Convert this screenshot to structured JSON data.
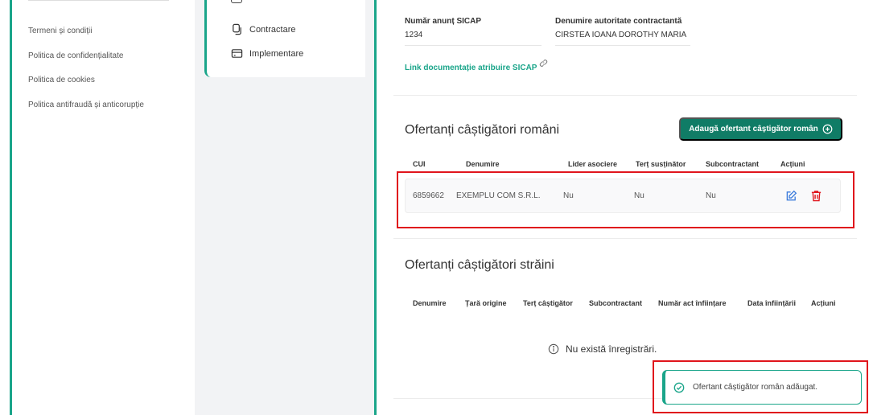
{
  "footer_links": [
    "Termeni și condiții",
    "Politica de confidențialitate",
    "Politica de cookies",
    "Politica antifraudă și anticorupție"
  ],
  "side_menu": {
    "items": [
      {
        "label": "Contractare",
        "icon": "document-copy-icon"
      },
      {
        "label": "Implementare",
        "icon": "credit-card-icon"
      }
    ]
  },
  "info": {
    "sicap_label": "Număr anunț SICAP",
    "sicap_value": "1234",
    "authority_label": "Denumire autoritate contractantă",
    "authority_value": "CIRSTEA IOANA DOROTHY MARIA",
    "doc_link": "Link documentație atribuire SICAP"
  },
  "romanian_winners": {
    "title": "Ofertanți câștigători români",
    "add_button": "Adaugă ofertant câștigător român",
    "columns": [
      "CUI",
      "Denumire",
      "Lider asociere",
      "Terț susținător",
      "Subcontractant",
      "Acțiuni"
    ],
    "rows": [
      {
        "cui": "6859662",
        "denumire": "EXEMPLU COM S.R.L.",
        "lider": "Nu",
        "tert": "Nu",
        "subcontractant": "Nu"
      }
    ]
  },
  "foreign_winners": {
    "title": "Ofertanți câștigători străini",
    "columns": [
      "Denumire",
      "Țară origine",
      "Terț câștigător",
      "Subcontractant",
      "Număr act înființare",
      "Data înființării",
      "Acțiuni"
    ],
    "empty_text": "Nu există înregistrări."
  },
  "toast": {
    "message": "Ofertant câștigător român adăugat."
  },
  "colors": {
    "accent": "#1aa58a",
    "button": "#107c66",
    "danger": "#e0151c",
    "edit": "#3b7bdc"
  }
}
